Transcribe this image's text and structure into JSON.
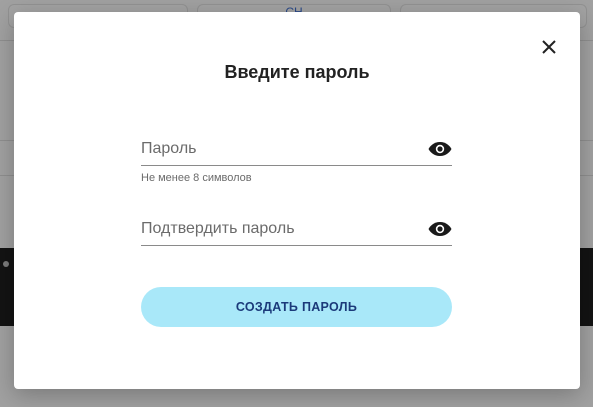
{
  "background": {
    "tab_label": "СН"
  },
  "modal": {
    "title": "Введите пароль",
    "close_icon": "close-icon",
    "password_field": {
      "placeholder": "Пароль",
      "value": "",
      "hint": "Не менее 8 символов",
      "icon": "eye-icon"
    },
    "confirm_field": {
      "placeholder": "Подтвердить пароль",
      "value": "",
      "icon": "eye-icon"
    },
    "submit_label": "СОЗДАТЬ ПАРОЛЬ"
  },
  "colors": {
    "button_bg": "#a9e8f9",
    "button_text": "#1b3a7a",
    "scrim": "rgba(0,0,0,0.35)"
  }
}
